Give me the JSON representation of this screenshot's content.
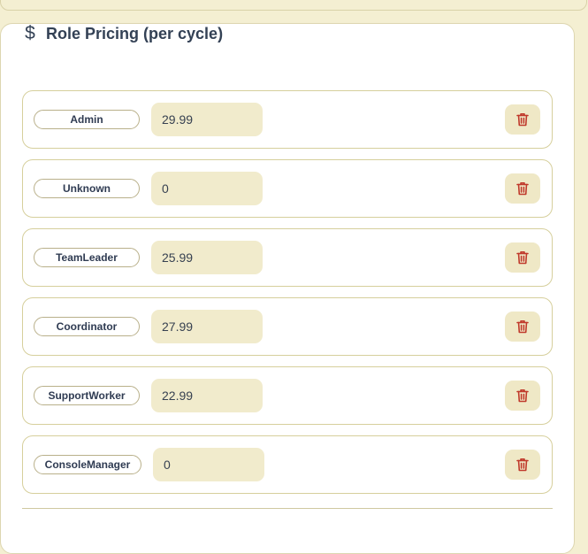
{
  "section": {
    "icon": "dollar-icon",
    "title": "Role Pricing (per cycle)"
  },
  "roles": [
    {
      "name": "Admin",
      "price": "29.99"
    },
    {
      "name": "Unknown",
      "price": "0"
    },
    {
      "name": "TeamLeader",
      "price": "25.99"
    },
    {
      "name": "Coordinator",
      "price": "27.99"
    },
    {
      "name": "SupportWorker",
      "price": "22.99"
    },
    {
      "name": "ConsoleManager",
      "price": "0"
    }
  ],
  "row_actions": {
    "delete_icon": "trash-icon"
  },
  "colors": {
    "page_background": "#f4efd2",
    "card_background": "#ffffff",
    "input_background": "#f1ebcc",
    "row_border": "#d6cf9c",
    "delete_icon": "#c0392b",
    "text": "#334155"
  }
}
